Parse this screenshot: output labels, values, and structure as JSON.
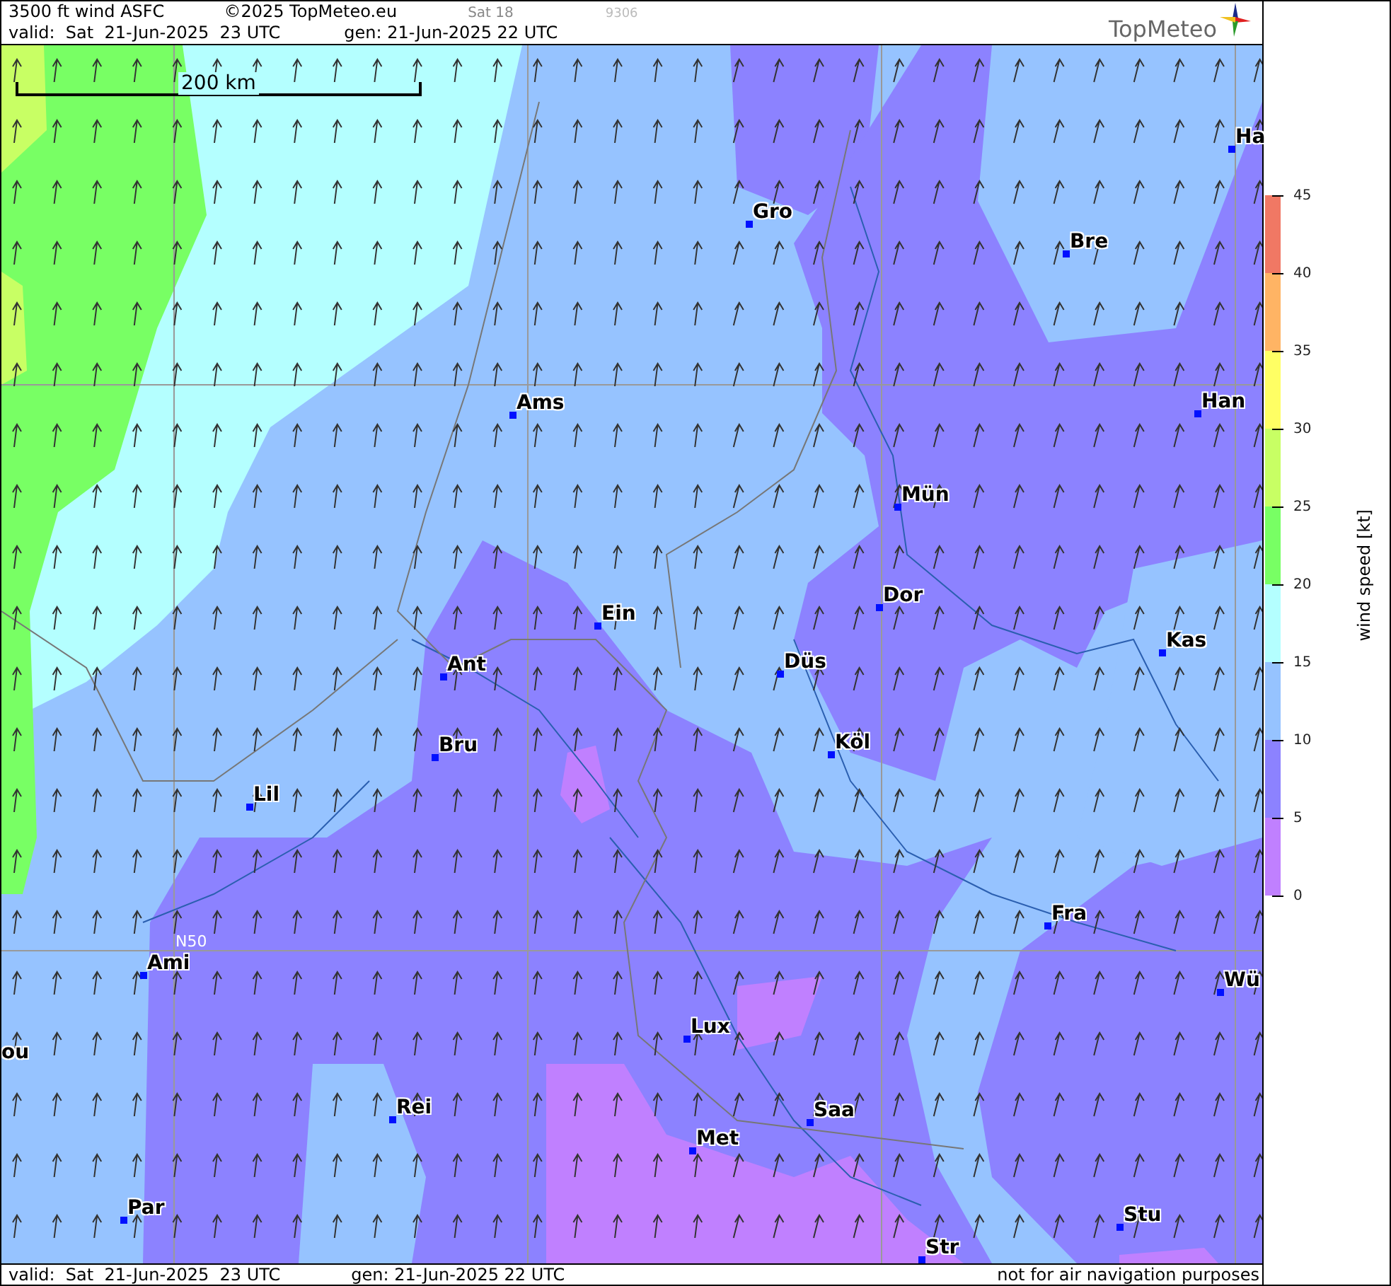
{
  "header": {
    "title": "3500 ft wind ASFC",
    "copyright": "©2025 TopMeteo.eu",
    "run_label": "Sat 18",
    "code": "9306",
    "valid": "valid:  Sat  21-Jun-2025  23 UTC",
    "generated": "gen: 21-Jun-2025 22 UTC",
    "logo_text": "TopMeteo"
  },
  "map": {
    "scale_label": "200 km",
    "latitude_label": "N50",
    "cities": [
      {
        "name": "Ha"
      },
      {
        "name": "Gro"
      },
      {
        "name": "Bre"
      },
      {
        "name": "Ams"
      },
      {
        "name": "Han"
      },
      {
        "name": "Mün"
      },
      {
        "name": "Dor"
      },
      {
        "name": "Ein"
      },
      {
        "name": "Kas"
      },
      {
        "name": "Ant"
      },
      {
        "name": "Düs"
      },
      {
        "name": "Köl"
      },
      {
        "name": "Bru"
      },
      {
        "name": "Lil"
      },
      {
        "name": "Fra"
      },
      {
        "name": "Ami"
      },
      {
        "name": "Wü"
      },
      {
        "name": "Lux"
      },
      {
        "name": "ou"
      },
      {
        "name": "Rei"
      },
      {
        "name": "Saa"
      },
      {
        "name": "Met"
      },
      {
        "name": "Par"
      },
      {
        "name": "Stu"
      },
      {
        "name": "Str"
      }
    ]
  },
  "legend": {
    "title": "wind speed [kt]",
    "bands": [
      {
        "color": "#f07864"
      },
      {
        "color": "#ffb464"
      },
      {
        "color": "#ffff64"
      },
      {
        "color": "#c8ff64"
      },
      {
        "color": "#78ff64"
      },
      {
        "color": "#b4ffff"
      },
      {
        "color": "#96c3ff"
      },
      {
        "color": "#8c82ff"
      },
      {
        "color": "#c080ff"
      }
    ],
    "ticks": [
      "45",
      "40",
      "35",
      "30",
      "25",
      "20",
      "15",
      "10",
      "5",
      "0"
    ]
  },
  "footer": {
    "valid": "valid:  Sat  21-Jun-2025  23 UTC",
    "generated": "gen: 21-Jun-2025 22 UTC",
    "disclaimer": "not for air navigation purposes"
  }
}
